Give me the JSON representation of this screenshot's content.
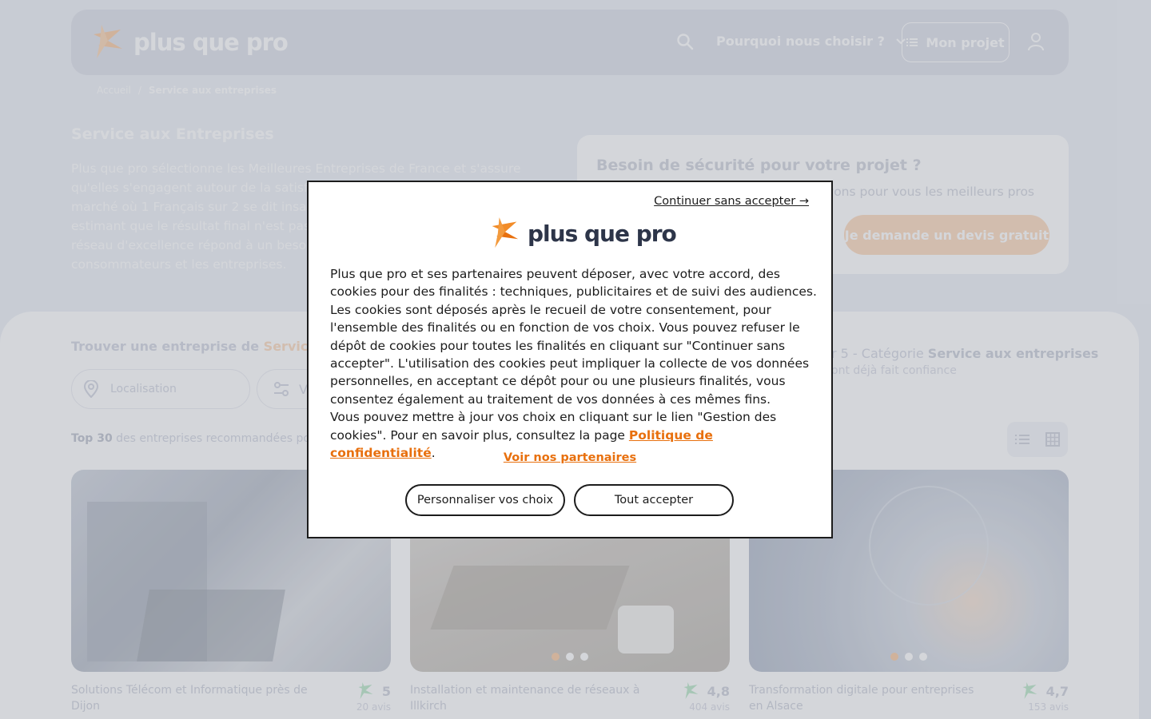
{
  "header": {
    "logo_text": "plus que pro",
    "nav_why": "Pourquoi nous choisir ?",
    "projet_label": "Mon projet"
  },
  "breadcrumb": {
    "home": "Accueil",
    "separator": "/",
    "current": "Service aux entreprises"
  },
  "hero": {
    "title": "Service aux Entreprises",
    "text_lines": [
      "Plus que pro sélectionne les Meilleures Entreprises de France et s'assure",
      "qu'elles s'engagent autour de la satisfa",
      "marché où 1 Français sur 2 se dit insatis",
      "estimant que le résultat final n'est pas a",
      "réseau d'excellence répond à un besoi",
      "consommateurs et les entreprises."
    ]
  },
  "security": {
    "title": "Besoin de sécurité pour votre projet ?",
    "subtitle": "uvons pour vous les meilleurs pros",
    "cta": "Je demande un devis gratuit"
  },
  "search": {
    "title_prefix": "Trouver une entreprise de",
    "title_accent": "Service aux",
    "location_placeholder": "Localisation",
    "filter_label": "V"
  },
  "listing": {
    "top_count": "Top 30",
    "top_rest": "des entreprises recommandées pour",
    "rank_prefix": "r 5 - Catégorie",
    "rank_category": "Service aux entreprises",
    "rank_sub": "ont déjà fait confiance"
  },
  "cards": [
    {
      "name": "Solutions Télécom et Informatique près de Dijon",
      "rating": "5",
      "reviews": "20 avis"
    },
    {
      "name": "Installation et maintenance de réseaux à Illkirch",
      "rating": "4,8",
      "reviews": "404 avis"
    },
    {
      "name": "Transformation digitale pour entreprises en Alsace",
      "rating": "4,7",
      "reviews": "153 avis"
    }
  ],
  "cookie_modal": {
    "skip": "Continuer sans accepter →",
    "logo_text": "plus que pro",
    "text_main": "Plus que pro et ses partenaires peuvent déposer, avec votre accord, des cookies pour des finalités : techniques, publicitaires et de suivi des audiences. Les cookies sont déposés après le recueil de votre consentement, pour l'ensemble des finalités ou en fonction de vos choix. Vous pouvez refuser le dépôt de cookies pour toutes les finalités en cliquant sur \"Continuer sans accepter\". L'utilisation des cookies peut impliquer la collecte de vos données personnelles, en acceptant ce dépôt pour ou une plusieurs finalités, vous consentez également au traitement de vos données à ces mêmes fins.",
    "text_update": "Vous pouvez mettre à jour vos choix en cliquant sur le lien \"Gestion des cookies\". Pour en savoir plus, consultez la page",
    "policy_link": "Politique de confidentialité",
    "period": ".",
    "partners_link": "Voir nos partenaires",
    "customize_button": "Personnaliser vos choix",
    "accept_button": "Tout accepter"
  },
  "colors": {
    "brand_orange": "#e8700e",
    "overlay": "rgba(40,52,72,0.2)"
  }
}
